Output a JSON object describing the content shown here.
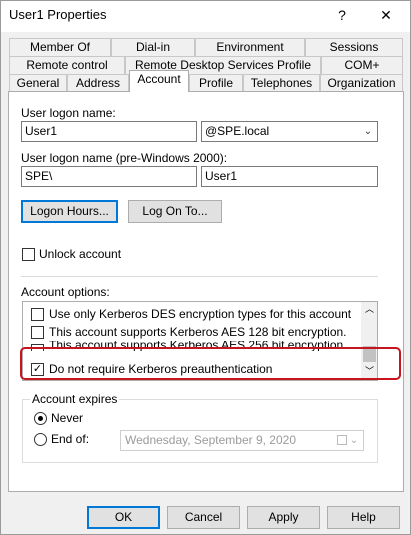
{
  "window": {
    "title": "User1 Properties",
    "help_label": "?",
    "close_label": "✕"
  },
  "tabs": {
    "row1": [
      "Member Of",
      "Dial-in",
      "Environment",
      "Sessions"
    ],
    "row2": [
      "Remote control",
      "Remote Desktop Services Profile",
      "COM+"
    ],
    "row3": [
      "General",
      "Address",
      "Account",
      "Profile",
      "Telephones",
      "Organization"
    ],
    "active": "Account"
  },
  "account": {
    "logon_name_label": "User logon name:",
    "logon_name_value": "User1",
    "domain_value": "@SPE.local",
    "pre2000_label": "User logon name (pre-Windows 2000):",
    "pre2000_domain": "SPE\\",
    "pre2000_user": "User1",
    "logon_hours_button": "Logon Hours...",
    "logon_to_button": "Log On To...",
    "unlock_label": "Unlock account",
    "options_label": "Account options:",
    "options": [
      {
        "label": "Use only Kerberos DES encryption types for this account",
        "checked": false
      },
      {
        "label": "This account supports Kerberos AES 128 bit encryption.",
        "checked": false
      },
      {
        "label": "This account supports Kerberos AES 256 bit encryption.",
        "checked": false
      },
      {
        "label": "Do not require Kerberos preauthentication",
        "checked": true
      }
    ],
    "expires_label": "Account expires",
    "never_label": "Never",
    "end_of_label": "End of:",
    "end_of_date": "Wednesday, September   9, 2020"
  },
  "footer": {
    "ok": "OK",
    "cancel": "Cancel",
    "apply": "Apply",
    "help": "Help"
  },
  "colors": {
    "highlight_border": "#c8141e",
    "focus_blue": "#0078d7"
  }
}
